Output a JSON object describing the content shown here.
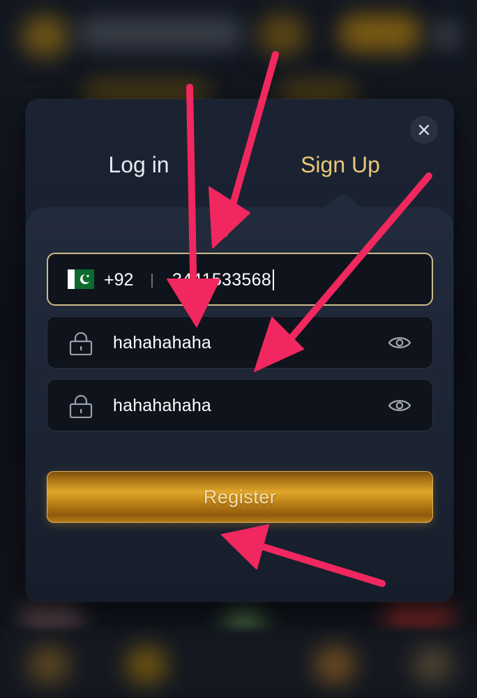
{
  "auth_modal": {
    "tabs": [
      {
        "label": "Log in",
        "active": false
      },
      {
        "label": "Sign Up",
        "active": true
      }
    ],
    "phone": {
      "country_flag": "pakistan-flag-icon",
      "country_code": "+92",
      "value": "3441533568"
    },
    "password": {
      "value": "hahahahaha",
      "icon": "lock-icon",
      "toggle_icon": "eye-icon"
    },
    "confirm_password": {
      "value": "hahahahaha",
      "icon": "lock-icon",
      "toggle_icon": "eye-icon"
    },
    "register_label": "Register",
    "close_icon": "close-icon"
  },
  "colors": {
    "accent_gold": "#e9c677",
    "annotation_arrow": "#f0285f",
    "field_bg": "#0f131b",
    "modal_bg": "#1b2333"
  }
}
